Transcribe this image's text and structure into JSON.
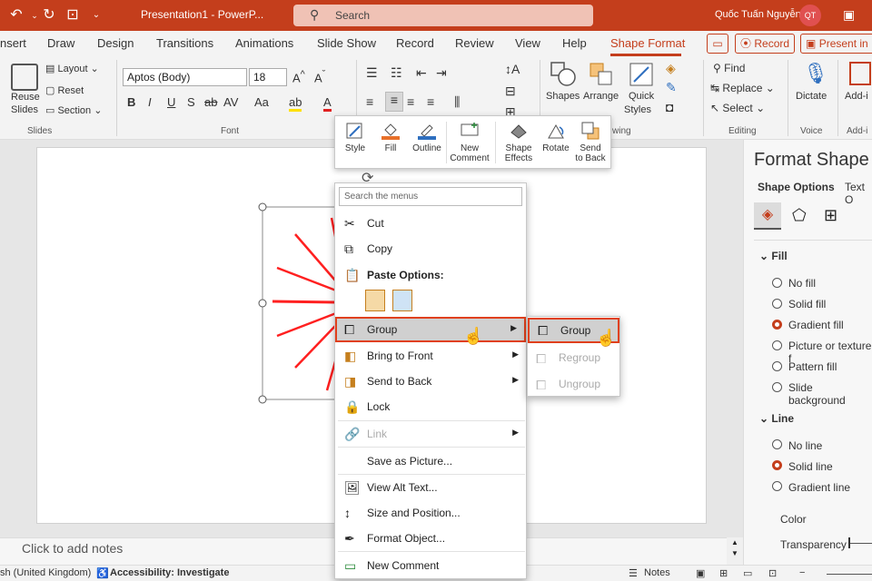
{
  "titlebar": {
    "title": "Presentation1  -  PowerP...",
    "search_placeholder": "Search",
    "user_name": "Quốc Tuấn Nguyễn",
    "user_initials": "QT"
  },
  "tabs": [
    {
      "label": "nsert"
    },
    {
      "label": "Draw"
    },
    {
      "label": "Design"
    },
    {
      "label": "Transitions"
    },
    {
      "label": "Animations"
    },
    {
      "label": "Slide Show"
    },
    {
      "label": "Record"
    },
    {
      "label": "Review"
    },
    {
      "label": "View"
    },
    {
      "label": "Help"
    },
    {
      "label": "Shape Format"
    }
  ],
  "tab_actions": {
    "record": "Record",
    "present": "Present in"
  },
  "ribbon": {
    "slides": {
      "reuse_label_1": "Reuse",
      "reuse_label_2": "Slides",
      "layout": "Layout",
      "reset": "Reset",
      "section": "Section",
      "group_label": "Slides"
    },
    "font": {
      "font_name": "Aptos (Body)",
      "font_size": "18",
      "group_label": "Font",
      "bold": "B",
      "italic": "I",
      "underline": "U",
      "strike": "S",
      "strike2": "ab",
      "spacing": "AV",
      "case": "Aa",
      "highlight": "ab",
      "color": "A"
    },
    "drawing": {
      "shapes": "Shapes",
      "arrange": "Arrange",
      "quick": "Quick",
      "styles": "Styles",
      "group_label": "wing"
    },
    "editing": {
      "find": "Find",
      "replace": "Replace",
      "select": "Select",
      "group_label": "Editing"
    },
    "voice": {
      "dictate": "Dictate",
      "group_label": "Voice"
    },
    "addins": {
      "label": "Add-i",
      "group_label": "Add-i"
    }
  },
  "mini_toolbar": {
    "style": "Style",
    "fill": "Fill",
    "outline": "Outline",
    "new_comment_1": "New",
    "new_comment_2": "Comment",
    "shape_effects_1": "Shape",
    "shape_effects_2": "Effects",
    "rotate": "Rotate",
    "send_back_1": "Send",
    "send_back_2": "to Back"
  },
  "context_menu": {
    "search_placeholder": "Search the menus",
    "cut": "Cut",
    "copy": "Copy",
    "paste_options": "Paste Options:",
    "group": "Group",
    "bring_to_front": "Bring to Front",
    "send_to_back": "Send to Back",
    "lock": "Lock",
    "link": "Link",
    "save_as_picture": "Save as Picture...",
    "view_alt_text": "View Alt Text...",
    "size_position": "Size and Position...",
    "format_object": "Format Object...",
    "new_comment": "New Comment"
  },
  "submenu": {
    "group": "Group",
    "regroup": "Regroup",
    "ungroup": "Ungroup"
  },
  "format_pane": {
    "title": "Format Shape",
    "tab_shape": "Shape Options",
    "tab_text": "Text O",
    "fill_section": "Fill",
    "fill_options": [
      "No fill",
      "Solid fill",
      "Gradient fill",
      "Picture or texture f",
      "Pattern fill",
      "Slide background"
    ],
    "fill_selected": "Gradient fill",
    "line_section": "Line",
    "line_options": [
      "No line",
      "Solid line",
      "Gradient line"
    ],
    "line_selected": "Solid line",
    "color_label": "Color",
    "transparency_label": "Transparency"
  },
  "notes": {
    "placeholder": "Click to add notes"
  },
  "statusbar": {
    "language": "sh (United Kingdom)",
    "accessibility": "Accessibility: Investigate",
    "notes": "Notes"
  },
  "colors": {
    "accent": "#c43e1c",
    "highlight_border": "#e0401c",
    "ray": "#ff2020"
  }
}
